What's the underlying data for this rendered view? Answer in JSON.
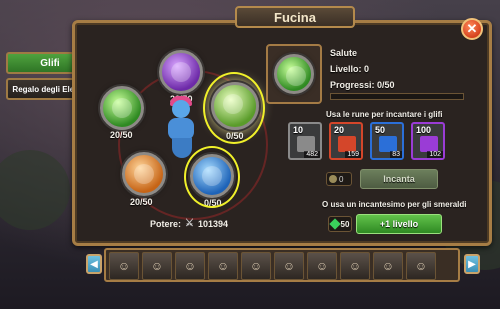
{
  "header": {
    "title": "Fucina",
    "close_symbol": "✕"
  },
  "tabs": [
    {
      "label": "Glifi",
      "active": true
    },
    {
      "label": "Regalo degli Elementi",
      "active": false
    }
  ],
  "glyphs": [
    {
      "color": "purple",
      "count": "20/50"
    },
    {
      "color": "green",
      "count": "20/50"
    },
    {
      "color": "lime-selected",
      "count": "0/50"
    },
    {
      "color": "orange",
      "count": "20/50"
    },
    {
      "color": "blue",
      "count": "0/50"
    }
  ],
  "power": {
    "label": "Potere:",
    "value": "101394"
  },
  "selected_glyph": {
    "name": "Salute",
    "level_label": "Livello: 0",
    "progress_label": "Progressi: 0/50",
    "progress": 0
  },
  "runes": {
    "section_title": "Usa le rune per incantare i glifi",
    "items": [
      {
        "level": "10",
        "qty": "482",
        "color": "#8a8a8a"
      },
      {
        "level": "20",
        "qty": "159",
        "color": "#d4462a"
      },
      {
        "level": "50",
        "qty": "83",
        "color": "#2b6fd8"
      },
      {
        "level": "100",
        "qty": "102",
        "color": "#9a3cd6"
      }
    ]
  },
  "enchant": {
    "coin_value": "0",
    "button_label": "Incanta"
  },
  "emerald_section": {
    "title": "O usa un incantesimo per gli smeraldi",
    "emerald_cost": "50",
    "level_button_label": "+1 livello"
  },
  "hero_strip": {
    "hero_count": 10
  },
  "colors": {
    "accent_green": "#4fa23e",
    "frame_gold": "#a67d45",
    "highlight_yellow": "#f0f02a"
  }
}
